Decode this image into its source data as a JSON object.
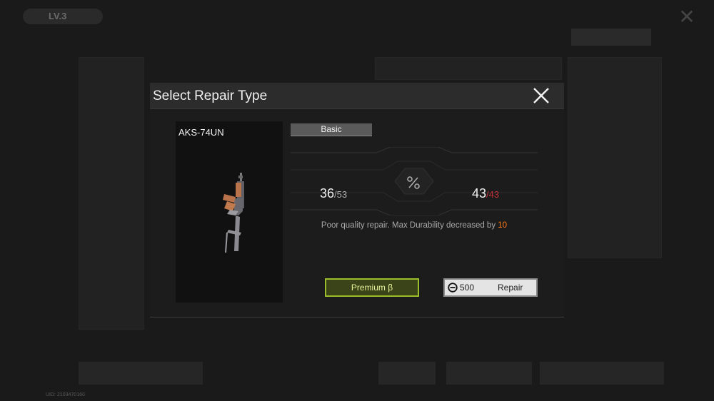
{
  "background": {
    "level": "LV.3",
    "uid": "UID: 2103470160"
  },
  "modal": {
    "title": "Select Repair Type",
    "item_name": "AKS-74UN",
    "tab_label": "Basic",
    "current_durability": "36",
    "current_max": "/53",
    "new_durability": "43",
    "new_max": "/43",
    "note_text": "Poor quality repair. Max Durability decreased by ",
    "note_value": "10",
    "premium_label": "Premium β",
    "repair_cost": "500",
    "repair_label": "Repair"
  },
  "colors": {
    "accent_green": "#9bbd2a",
    "warning_orange": "#ff7a1a",
    "max_red": "#c0303a"
  }
}
